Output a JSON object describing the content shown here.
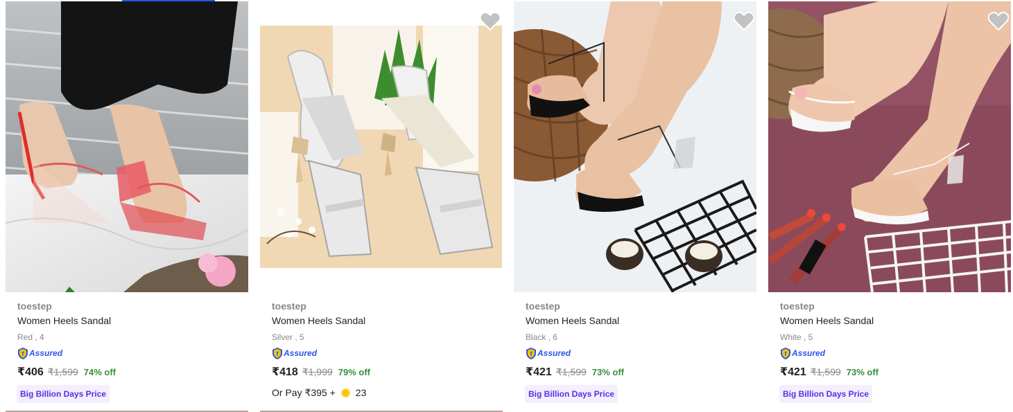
{
  "products": [
    {
      "brand": "toestep",
      "title": "Women Heels Sandal",
      "variant": "Red , 4",
      "assured": "Assured",
      "price": "₹406",
      "mrp": "₹1,599",
      "discount": "74% off",
      "badge": "Big Billion Days Price",
      "image_icon": "red-clear-strap-block-heel-sandal-photo"
    },
    {
      "brand": "toestep",
      "title": "Women Heels Sandal",
      "variant": "Silver , 5",
      "assured": "Assured",
      "price": "₹418",
      "mrp": "₹1,999",
      "discount": "79% off",
      "pay_option": "Or Pay ₹395 +",
      "coins": "23",
      "image_icon": "silver-ankle-strap-cone-heel-sandal-photo"
    },
    {
      "brand": "toestep",
      "title": "Women Heels Sandal",
      "variant": "Black , 6",
      "assured": "Assured",
      "price": "₹421",
      "mrp": "₹1,599",
      "discount": "73% off",
      "badge": "Big Billion Days Price",
      "image_icon": "black-clear-toe-ring-heel-sandal-photo"
    },
    {
      "brand": "toestep",
      "title": "Women Heels Sandal",
      "variant": "White , 5",
      "assured": "Assured",
      "price": "₹421",
      "mrp": "₹1,599",
      "discount": "73% off",
      "badge": "Big Billion Days Price",
      "image_icon": "white-clear-toe-ring-heel-sandal-photo"
    }
  ],
  "colors": {
    "assured_blue": "#2a55e5",
    "discount_green": "#388e3c",
    "badge_bg": "#f3effe",
    "badge_text": "#5a2de6",
    "muted_text": "#878787"
  }
}
